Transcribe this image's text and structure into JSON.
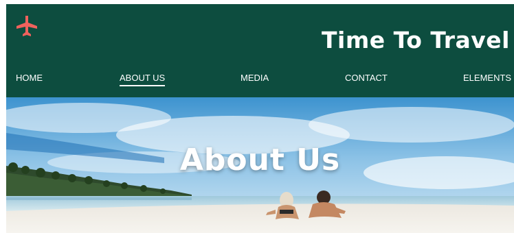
{
  "header": {
    "site_title": "Time To Travel",
    "logo_icon": "airplane-icon",
    "logo_color": "#f0625d",
    "background": "#0d4d3f"
  },
  "nav": {
    "items": [
      {
        "label": "HOME",
        "active": false
      },
      {
        "label": "ABOUT US",
        "active": true
      },
      {
        "label": "MEDIA",
        "active": false
      },
      {
        "label": "CONTACT",
        "active": false
      },
      {
        "label": "ELEMENTS",
        "active": false
      }
    ]
  },
  "hero": {
    "title": "About Us",
    "image": "beach-photo"
  }
}
